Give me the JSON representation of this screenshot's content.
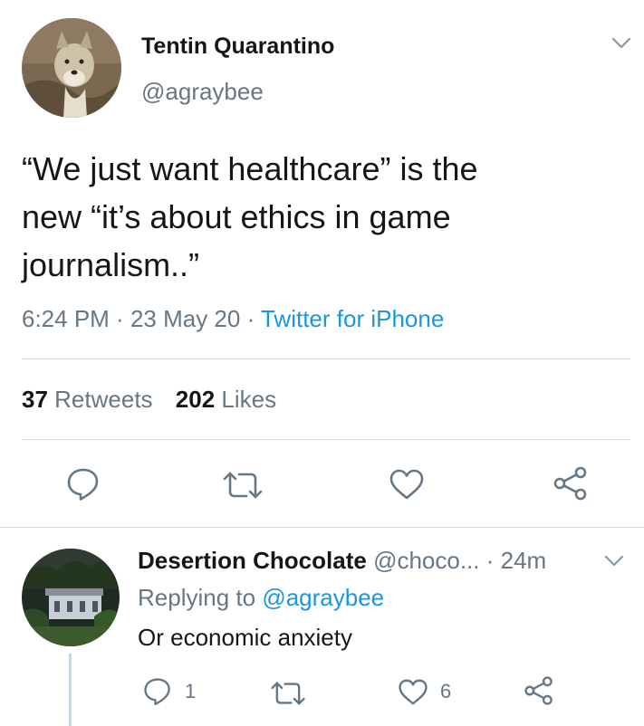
{
  "tweet": {
    "author_name": "Tentin Quarantino",
    "author_handle": "@agraybee",
    "text_line1": "“We just want healthcare” is the",
    "text_line2": "new “it’s about ethics in game",
    "text_line3": "journalism..”",
    "time": "6:24 PM",
    "sep1": " · ",
    "date": "23 May 20",
    "sep2": " · ",
    "source": "Twitter for iPhone",
    "retweet_count": "37",
    "retweet_label": "Retweets",
    "like_count": "202",
    "like_label": "Likes",
    "icons": [
      "chevron-down-icon",
      "reply-icon",
      "retweet-icon",
      "like-icon",
      "share-icon"
    ]
  },
  "reply": {
    "author_name": "Desertion Chocolate",
    "author_handle": "@choco...",
    "time_ago": "· 24m",
    "replying_prefix": "Replying to ",
    "replying_to": "@agraybee",
    "text": "Or economic anxiety",
    "reply_count": "1",
    "like_count": "6"
  },
  "colors": {
    "link": "#1b95e0",
    "muted": "#657786",
    "divider": "#d9dee2",
    "text": "#14171a"
  }
}
